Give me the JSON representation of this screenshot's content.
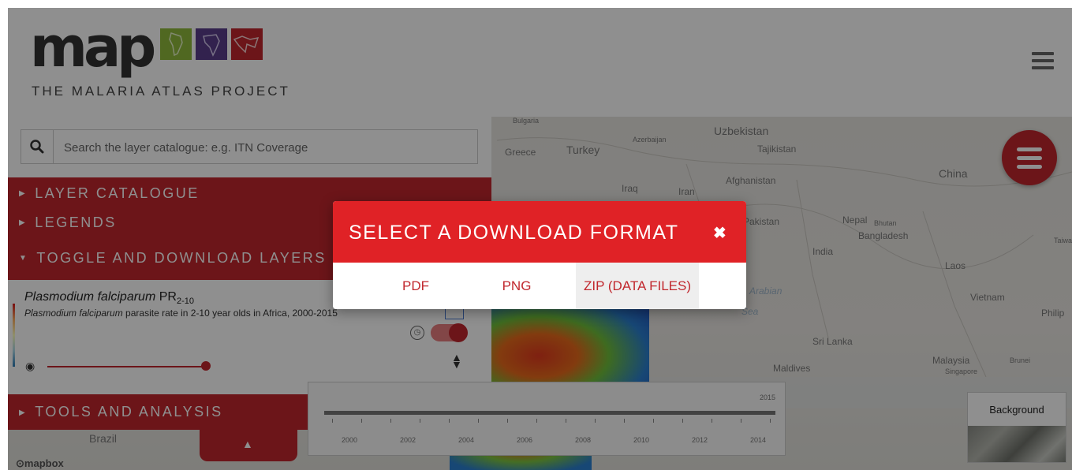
{
  "header": {
    "logo_word": "map",
    "logo_subtitle": "THE MALARIA ATLAS PROJECT",
    "menu_icon": "hamburger-menu-icon"
  },
  "search": {
    "placeholder": "Search the layer catalogue: e.g. ITN Coverage",
    "icon": "search-icon"
  },
  "sidebar": {
    "sections": [
      {
        "label": "LAYER CATALOGUE",
        "expanded": false
      },
      {
        "label": "LEGENDS",
        "expanded": false
      },
      {
        "label": "TOGGLE AND DOWNLOAD LAYERS",
        "expanded": true
      },
      {
        "label": "TOOLS AND ANALYSIS",
        "expanded": false
      }
    ],
    "layer": {
      "title_italic": "Plasmodium falciparum",
      "title_rest": "PR",
      "title_sub": "2-10",
      "desc_italic": "Plasmodium falciparum",
      "desc_rest": " parasite rate in 2-10 year olds in Africa, 2000-2015",
      "opacity": 1.0,
      "visible": true
    }
  },
  "map": {
    "labels": [
      "Bulgaria",
      "Greece",
      "Turkey",
      "Azerbaijan",
      "Uzbekistan",
      "Tajikistan",
      "China",
      "Iraq",
      "Iran",
      "Afghanistan",
      "Pakistan",
      "Nepal",
      "Bhutan",
      "Bangladesh",
      "India",
      "Laos",
      "Vietnam",
      "Philip",
      "Taiwa",
      "Sri Lanka",
      "Maldives",
      "Malaysia",
      "Brunei",
      "Singapore",
      "Brazil",
      "Sea",
      "Arabian"
    ],
    "attribution": "mapbox"
  },
  "timeline": {
    "years": [
      "2000",
      "2002",
      "2004",
      "2006",
      "2008",
      "2010",
      "2012",
      "2014"
    ],
    "current": "2015"
  },
  "background": {
    "label": "Background"
  },
  "modal": {
    "title": "SELECT A DOWNLOAD FORMAT",
    "close": "✖",
    "formats": [
      "PDF",
      "PNG",
      "ZIP (DATA FILES)"
    ]
  },
  "colors": {
    "primary_red": "#c1272d",
    "modal_red": "#e02226",
    "overlay": "rgba(0,0,0,0.44)"
  }
}
